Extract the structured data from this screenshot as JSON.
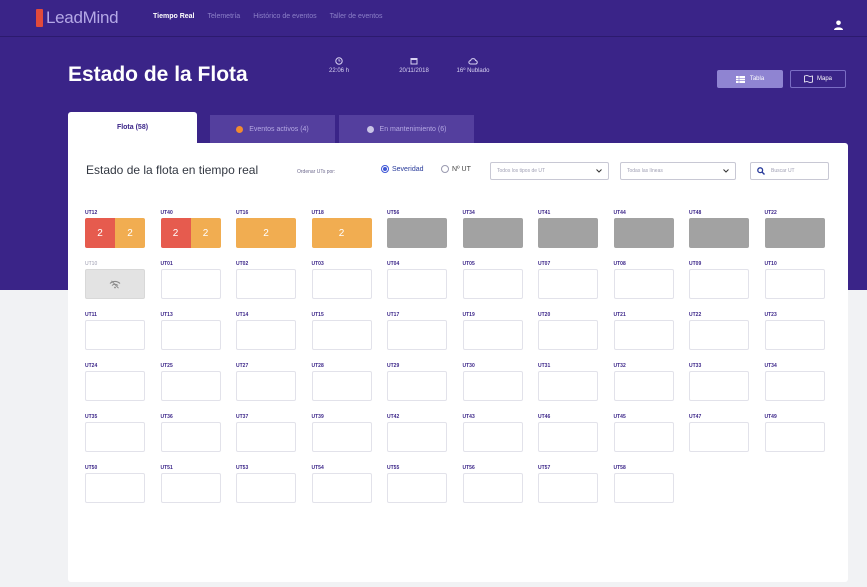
{
  "app": {
    "logo_text": "LeadMind"
  },
  "nav": {
    "items": [
      {
        "label": "Tiempo Real",
        "active": true
      },
      {
        "label": "Telemetría",
        "active": false
      },
      {
        "label": "Histórico de eventos",
        "active": false
      },
      {
        "label": "Taller de eventos",
        "active": false
      }
    ],
    "user_icon": "user-icon"
  },
  "header": {
    "title": "Estado de la Flota",
    "info": [
      {
        "icon": "clock-icon",
        "value": "22:06 h"
      },
      {
        "icon": "calendar-icon",
        "value": "20/11/2018"
      },
      {
        "icon": "cloud-icon",
        "value": "16º Nublado"
      }
    ],
    "buttons": [
      {
        "icon": "table-icon",
        "label": "Tabla"
      },
      {
        "icon": "map-icon",
        "label": "Mapa"
      }
    ]
  },
  "tabs": [
    {
      "label": "Flota (58)",
      "active": true
    },
    {
      "label": "Eventos activos (4)",
      "dot_color": "#f28b2e"
    },
    {
      "label": "En mantenimiento (6)",
      "dot_color": "#c9c4e6"
    }
  ],
  "panel": {
    "title": "Estado de la flota en tiempo real",
    "sort_label": "Ordenar UTs por:",
    "sort_options": [
      {
        "label": "Severidad",
        "selected": true
      },
      {
        "label": "Nº UT",
        "selected": false
      }
    ],
    "filter_types_placeholder": "Todos los tipos de UT",
    "filter_lines_placeholder": "Todas las líneas",
    "search_placeholder": "Buscar UT"
  },
  "colors": {
    "brand": "#3a2488",
    "critical": "#e65b4e",
    "warning": "#f1ad51",
    "maintenance": "#a2a2a2"
  },
  "units": [
    {
      "id": "UT12",
      "status": "alert",
      "segments": [
        {
          "color": "red",
          "value": "2"
        },
        {
          "color": "orange",
          "value": "2"
        }
      ]
    },
    {
      "id": "UT40",
      "status": "alert",
      "segments": [
        {
          "color": "red",
          "value": "2"
        },
        {
          "color": "orange",
          "value": "2"
        }
      ]
    },
    {
      "id": "UT16",
      "status": "alert",
      "segments": [
        {
          "color": "orange",
          "value": "2"
        }
      ]
    },
    {
      "id": "UT18",
      "status": "alert",
      "segments": [
        {
          "color": "orange",
          "value": "2"
        }
      ]
    },
    {
      "id": "UT56",
      "status": "maintenance"
    },
    {
      "id": "UT34",
      "status": "maintenance"
    },
    {
      "id": "UT41",
      "status": "maintenance"
    },
    {
      "id": "UT44",
      "status": "maintenance"
    },
    {
      "id": "UT48",
      "status": "maintenance"
    },
    {
      "id": "UT22",
      "status": "maintenance"
    },
    {
      "id": "UT10",
      "status": "offline",
      "icon": "no-signal-icon"
    },
    {
      "id": "UT01",
      "status": "normal"
    },
    {
      "id": "UT02",
      "status": "normal"
    },
    {
      "id": "UT03",
      "status": "normal"
    },
    {
      "id": "UT04",
      "status": "normal"
    },
    {
      "id": "UT05",
      "status": "normal"
    },
    {
      "id": "UT07",
      "status": "normal"
    },
    {
      "id": "UT08",
      "status": "normal"
    },
    {
      "id": "UT09",
      "status": "normal"
    },
    {
      "id": "UT10",
      "status": "normal"
    },
    {
      "id": "UT11",
      "status": "normal"
    },
    {
      "id": "UT13",
      "status": "normal"
    },
    {
      "id": "UT14",
      "status": "normal"
    },
    {
      "id": "UT15",
      "status": "normal"
    },
    {
      "id": "UT17",
      "status": "normal"
    },
    {
      "id": "UT19",
      "status": "normal"
    },
    {
      "id": "UT20",
      "status": "normal"
    },
    {
      "id": "UT21",
      "status": "normal"
    },
    {
      "id": "UT22",
      "status": "normal"
    },
    {
      "id": "UT23",
      "status": "normal"
    },
    {
      "id": "UT24",
      "status": "normal"
    },
    {
      "id": "UT25",
      "status": "normal"
    },
    {
      "id": "UT27",
      "status": "normal"
    },
    {
      "id": "UT28",
      "status": "normal"
    },
    {
      "id": "UT29",
      "status": "normal"
    },
    {
      "id": "UT30",
      "status": "normal"
    },
    {
      "id": "UT31",
      "status": "normal"
    },
    {
      "id": "UT32",
      "status": "normal"
    },
    {
      "id": "UT33",
      "status": "normal"
    },
    {
      "id": "UT34",
      "status": "normal"
    },
    {
      "id": "UT35",
      "status": "normal"
    },
    {
      "id": "UT36",
      "status": "normal"
    },
    {
      "id": "UT37",
      "status": "normal"
    },
    {
      "id": "UT39",
      "status": "normal"
    },
    {
      "id": "UT42",
      "status": "normal"
    },
    {
      "id": "UT43",
      "status": "normal"
    },
    {
      "id": "UT46",
      "status": "normal"
    },
    {
      "id": "UT45",
      "status": "normal"
    },
    {
      "id": "UT47",
      "status": "normal"
    },
    {
      "id": "UT49",
      "status": "normal"
    },
    {
      "id": "UT50",
      "status": "normal"
    },
    {
      "id": "UT51",
      "status": "normal"
    },
    {
      "id": "UT53",
      "status": "normal"
    },
    {
      "id": "UT54",
      "status": "normal"
    },
    {
      "id": "UT55",
      "status": "normal"
    },
    {
      "id": "UT56",
      "status": "normal"
    },
    {
      "id": "UT57",
      "status": "normal"
    },
    {
      "id": "UT58",
      "status": "normal"
    }
  ]
}
